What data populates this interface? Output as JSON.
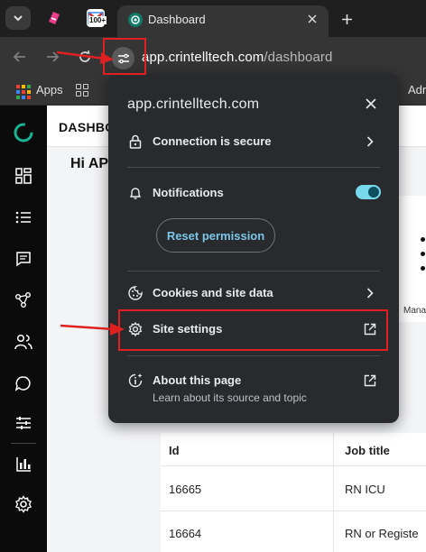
{
  "browser": {
    "pinned_tabs": [
      {
        "icon": "pink-app-icon",
        "color": "#e83e8c"
      },
      {
        "icon": "gmail-icon",
        "badge": "100+"
      }
    ],
    "active_tab": {
      "title": "Dashboard",
      "favicon": "crintell-logo-icon"
    },
    "address_bar": {
      "host": "app.crintelltech.com",
      "path": "/dashboard"
    },
    "bookmarks": [
      {
        "label": "Apps"
      },
      {
        "label": "Adr"
      }
    ]
  },
  "page": {
    "header_title": "DASHBO",
    "greeting": "Hi AP",
    "side_label": "Mana",
    "sidebar_icons": [
      "dashboard-icon",
      "list-icon",
      "message-icon",
      "network-icon",
      "users-icon",
      "chat-icon",
      "sliders-icon",
      "chart-icon",
      "settings-icon"
    ],
    "table": {
      "columns": [
        "Id",
        "Job title"
      ],
      "rows": [
        {
          "id": "16665",
          "title": "RN ICU"
        },
        {
          "id": "16664",
          "title": "RN or Registe"
        }
      ]
    }
  },
  "popup": {
    "domain": "app.crintelltech.com",
    "connection": "Connection is secure",
    "notifications": "Notifications",
    "notifications_enabled": true,
    "reset_permission": "Reset permission",
    "cookies": "Cookies and site data",
    "site_settings": "Site settings",
    "about_title": "About this page",
    "about_subtitle": "Learn about its source and topic"
  },
  "colors": {
    "accent_toggle": "#78d9ec",
    "annotation_red": "#e02020",
    "popup_bg": "#292a2d"
  }
}
